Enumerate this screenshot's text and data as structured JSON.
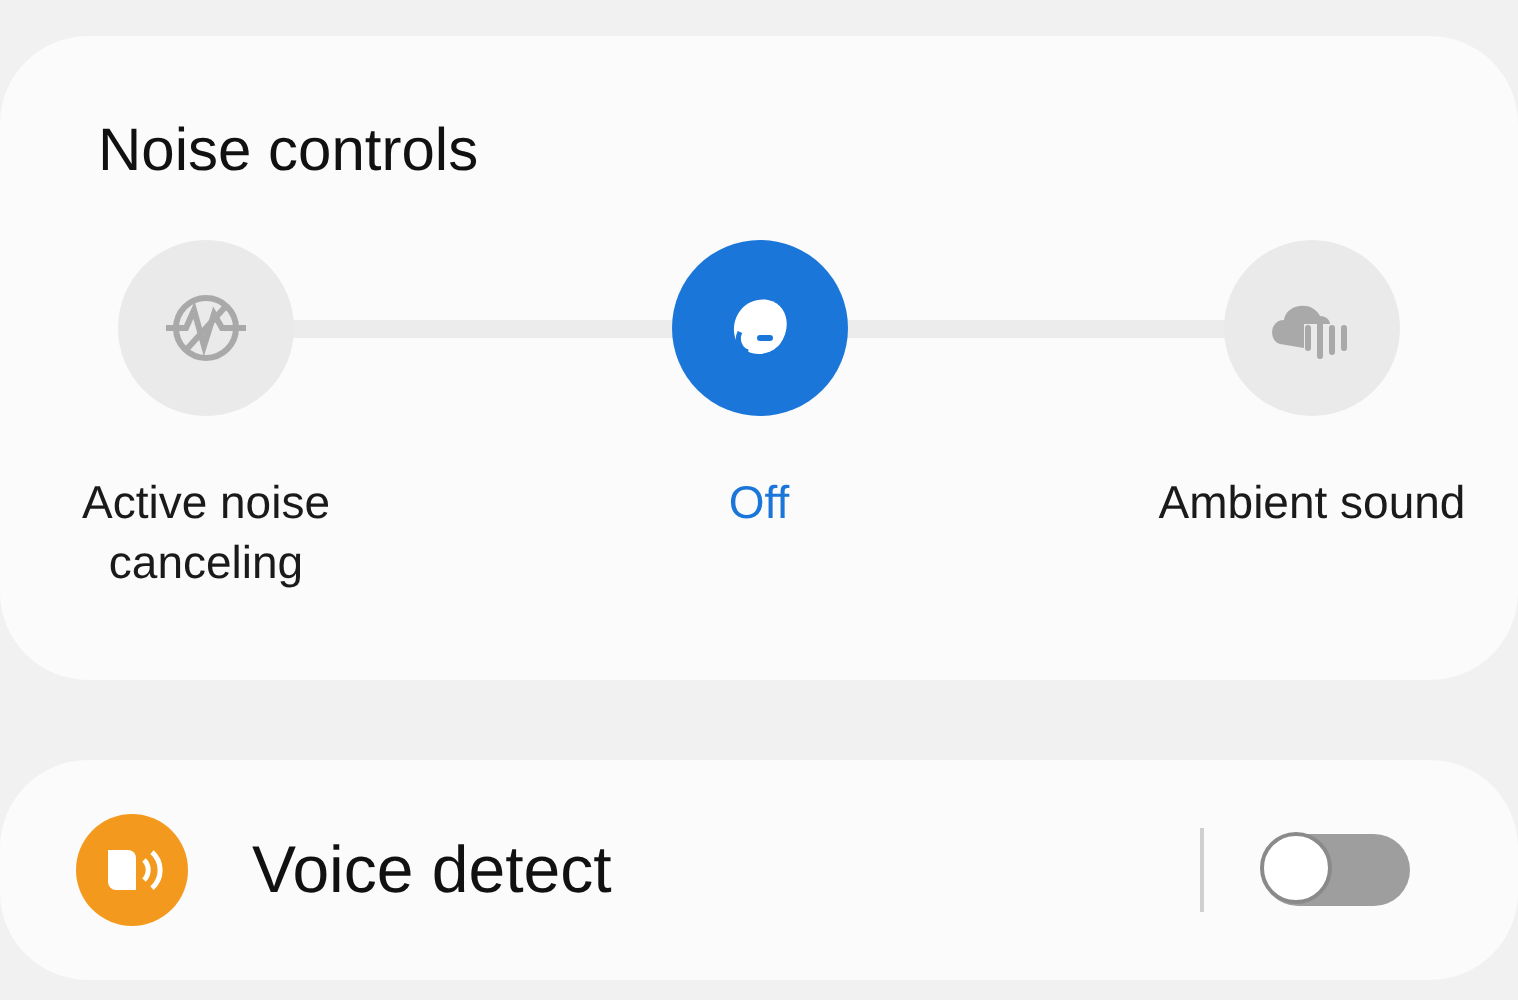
{
  "noise_controls": {
    "title": "Noise controls",
    "options": [
      {
        "kind": "anc",
        "label": "Active noise canceling",
        "selected": false
      },
      {
        "kind": "off",
        "label": "Off",
        "selected": true
      },
      {
        "kind": "ambient",
        "label": "Ambient sound",
        "selected": false
      }
    ]
  },
  "voice_detect": {
    "label": "Voice detect",
    "on": false
  }
}
